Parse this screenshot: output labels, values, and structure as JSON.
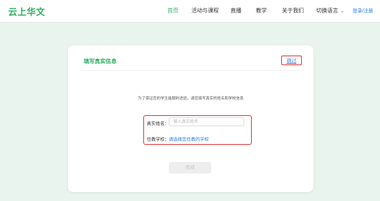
{
  "header": {
    "logo": "云上华文",
    "nav": [
      "首页",
      "活动与课程",
      "直播",
      "教学",
      "关于我们",
      "切换语言"
    ],
    "active_index": 0,
    "login": "登录/注册"
  },
  "card": {
    "title": "填写真实信息",
    "skip": "跳过",
    "notice": "为了保证您的学生能顺利进班，请您填写真实的姓名和学校信息",
    "name_label": "真实姓名：",
    "name_placeholder": "输入真实姓名",
    "school_label": "任教学校：",
    "school_link": "请选择您任教的学校",
    "submit": "完成"
  },
  "colors": {
    "brand_green": "#2fae62",
    "link_blue": "#2a7ee0",
    "highlight_red": "#e02b2b",
    "background": "#e9f4ee"
  }
}
